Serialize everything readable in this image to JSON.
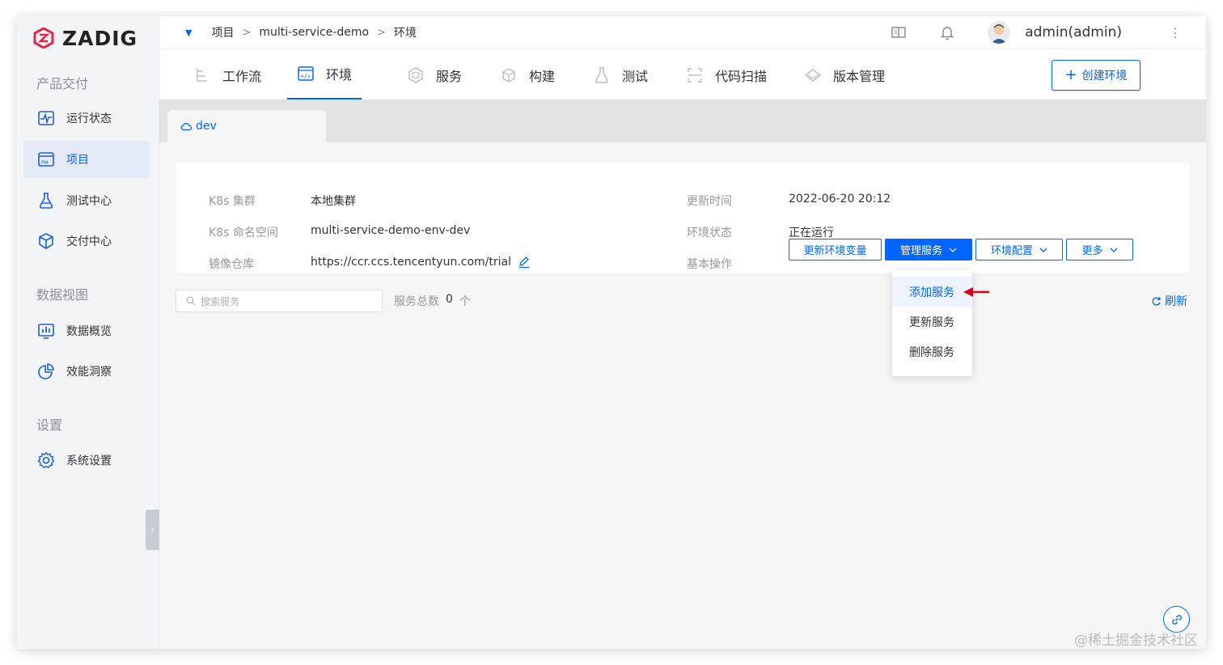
{
  "app": {
    "logo_text": "ZADIG"
  },
  "sidebar": {
    "sections": [
      {
        "title": "产品交付"
      },
      {
        "title": "数据视图"
      },
      {
        "title": "设置"
      }
    ],
    "items": [
      {
        "label": "运行状态",
        "icon": "activity-monitor-icon"
      },
      {
        "label": "项目",
        "icon": "project-pm-icon"
      },
      {
        "label": "测试中心",
        "icon": "flask-icon"
      },
      {
        "label": "交付中心",
        "icon": "package-icon"
      },
      {
        "label": "数据概览",
        "icon": "chart-board-icon"
      },
      {
        "label": "效能洞察",
        "icon": "pie-chart-icon"
      },
      {
        "label": "系统设置",
        "icon": "gear-icon"
      }
    ]
  },
  "breadcrumb": {
    "items": [
      "项目",
      "multi-service-demo",
      "环境"
    ],
    "separator": ">"
  },
  "header": {
    "username": "admin(admin)"
  },
  "tabs": [
    {
      "label": "工作流",
      "icon": "workflow-icon"
    },
    {
      "label": "环境",
      "icon": "code-icon"
    },
    {
      "label": "服务",
      "icon": "cube-icon"
    },
    {
      "label": "构建",
      "icon": "box-icon"
    },
    {
      "label": "测试",
      "icon": "beaker-icon"
    },
    {
      "label": "代码扫描",
      "icon": "scan-icon"
    },
    {
      "label": "版本管理",
      "icon": "diamond-icon"
    }
  ],
  "create_env_label": "创建环境",
  "env_tab": {
    "name": "dev"
  },
  "env_info": {
    "cluster_label": "K8s 集群",
    "cluster_value": "本地集群",
    "namespace_label": "K8s 命名空间",
    "namespace_value": "multi-service-demo-env-dev",
    "registry_label": "镜像仓库",
    "registry_value": "https://ccr.ccs.tencentyun.com/trial",
    "updated_label": "更新时间",
    "updated_value": "2022-06-20 20:12",
    "status_label": "环境状态",
    "status_value": "正在运行",
    "ops_label": "基本操作"
  },
  "ops": {
    "update_vars": "更新环境变量",
    "manage_services": "管理服务",
    "env_config": "环境配置",
    "more": "更多"
  },
  "search": {
    "placeholder": "搜索服务"
  },
  "service_count": {
    "label": "服务总数",
    "value": "0",
    "unit": "个"
  },
  "refresh_label": "刷新",
  "dropdown": {
    "items": [
      "添加服务",
      "更新服务",
      "删除服务"
    ]
  },
  "watermark": "@稀土掘金技术社区",
  "colors": {
    "accent": "#0066ff",
    "annotation_arrow": "#d0021b"
  }
}
